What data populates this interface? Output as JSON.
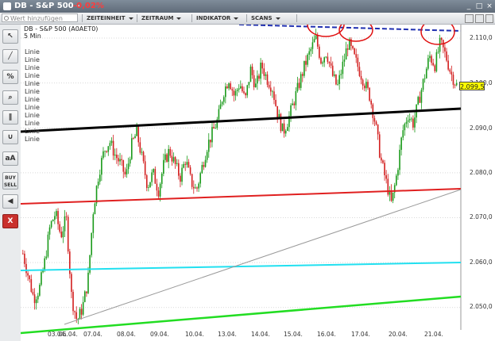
{
  "window": {
    "title": "DB - S&P 500 -",
    "change": "-0,02%",
    "change_color": "#ff3b3b",
    "controls": [
      "minimize-icon",
      "maximize-icon",
      "close-icon"
    ]
  },
  "toolbar": {
    "search_placeholder": "Wert hinzufügen",
    "menus": [
      "ZEITEINHEIT",
      "ZEITRAUM",
      "INDIKATOR",
      "SCANS"
    ],
    "right_icons": [
      "lock-icon",
      "print-icon",
      "settings-icon"
    ]
  },
  "tools": [
    {
      "name": "cursor-tool",
      "icon": "cursor-icon",
      "label": "↖"
    },
    {
      "name": "line-tool",
      "icon": "line-icon",
      "label": "╱"
    },
    {
      "name": "percent-tool",
      "icon": "percent-icon",
      "label": "%"
    },
    {
      "name": "zoom-tool",
      "icon": "magnifier-icon",
      "label": "⌕"
    },
    {
      "name": "channel-tool",
      "icon": "parallel-lines-icon",
      "label": "∥"
    },
    {
      "name": "curve-tool",
      "icon": "curve-icon",
      "label": "∪"
    },
    {
      "name": "text-tool",
      "icon": "text-icon",
      "label": "aA"
    },
    {
      "name": "buy-sell-tool",
      "icon": "buy-sell-icon",
      "label": "BUY SELL"
    },
    {
      "name": "sound-tool",
      "icon": "speaker-icon",
      "label": "◀"
    },
    {
      "name": "close-tool",
      "icon": "close-icon",
      "label": "X"
    }
  ],
  "chart": {
    "header_line1": "DB - S&P 500 (A0AET0)",
    "header_line2": "5 Min",
    "drawing_labels": [
      "Linie",
      "Linie",
      "Linie",
      "Linie",
      "Linie",
      "Linie",
      "Linie",
      "Linie",
      "Linie",
      "Linie",
      "Linie",
      "Linie"
    ],
    "current_price": "2.099,5",
    "colors": {
      "up": "#1a9a1a",
      "down": "#d21e1e",
      "black_line": "#000000",
      "red_line": "#e02020",
      "cyan_line": "#22e0f0",
      "green_line": "#22dd22",
      "blue_dash": "#1f2fb0",
      "circle": "#e01010"
    }
  },
  "chart_data": {
    "type": "candlestick",
    "y_ticks": [
      "2.110,0",
      "2.100,0",
      "2.090,0",
      "2.080,0",
      "2.070,0",
      "2.060,0",
      "2.050,0"
    ],
    "x_ticks": [
      "03.04.",
      "06.04.",
      "07.04.",
      "08.04.",
      "09.04.",
      "10.04.",
      "13.04.",
      "14.04.",
      "15.04.",
      "16.04.",
      "17.04.",
      "20.04.",
      "21.04."
    ],
    "ylim": [
      2045,
      2113
    ],
    "close_path": [
      [
        0,
        2062
      ],
      [
        1,
        2057
      ],
      [
        2,
        2052
      ],
      [
        3,
        2054
      ],
      [
        4,
        2060
      ],
      [
        5,
        2068
      ],
      [
        6,
        2071
      ],
      [
        7,
        2066
      ],
      [
        8,
        2070
      ],
      [
        9,
        2052
      ],
      [
        10,
        2047
      ],
      [
        11,
        2050
      ],
      [
        12,
        2056
      ],
      [
        13,
        2072
      ],
      [
        14,
        2080
      ],
      [
        15,
        2085
      ],
      [
        16,
        2087
      ],
      [
        17,
        2084
      ],
      [
        18,
        2082
      ],
      [
        19,
        2079
      ],
      [
        20,
        2086
      ],
      [
        21,
        2089
      ],
      [
        22,
        2083
      ],
      [
        23,
        2077
      ],
      [
        24,
        2080
      ],
      [
        25,
        2076
      ],
      [
        26,
        2082
      ],
      [
        27,
        2085
      ],
      [
        28,
        2082
      ],
      [
        29,
        2079
      ],
      [
        30,
        2083
      ],
      [
        31,
        2078
      ],
      [
        32,
        2076
      ],
      [
        33,
        2081
      ],
      [
        34,
        2086
      ],
      [
        35,
        2089
      ],
      [
        36,
        2092
      ],
      [
        37,
        2098
      ],
      [
        38,
        2101
      ],
      [
        39,
        2097
      ],
      [
        40,
        2100
      ],
      [
        41,
        2096
      ],
      [
        42,
        2103
      ],
      [
        43,
        2099
      ],
      [
        44,
        2104
      ],
      [
        45,
        2101
      ],
      [
        46,
        2099
      ],
      [
        47,
        2093
      ],
      [
        48,
        2089
      ],
      [
        49,
        2092
      ],
      [
        50,
        2096
      ],
      [
        51,
        2100
      ],
      [
        52,
        2104
      ],
      [
        53,
        2107
      ],
      [
        54,
        2110
      ],
      [
        55,
        2105
      ],
      [
        56,
        2107
      ],
      [
        57,
        2102
      ],
      [
        58,
        2099
      ],
      [
        59,
        2104
      ],
      [
        60,
        2109
      ],
      [
        61,
        2106
      ],
      [
        62,
        2103
      ],
      [
        63,
        2100
      ],
      [
        64,
        2097
      ],
      [
        65,
        2091
      ],
      [
        66,
        2083
      ],
      [
        67,
        2078
      ],
      [
        68,
        2073
      ],
      [
        69,
        2080
      ],
      [
        70,
        2089
      ],
      [
        71,
        2093
      ],
      [
        72,
        2091
      ],
      [
        73,
        2096
      ],
      [
        74,
        2101
      ],
      [
        75,
        2106
      ],
      [
        76,
        2104
      ],
      [
        77,
        2109
      ],
      [
        78,
        2106
      ],
      [
        79,
        2102
      ],
      [
        80,
        2099.5
      ]
    ]
  }
}
